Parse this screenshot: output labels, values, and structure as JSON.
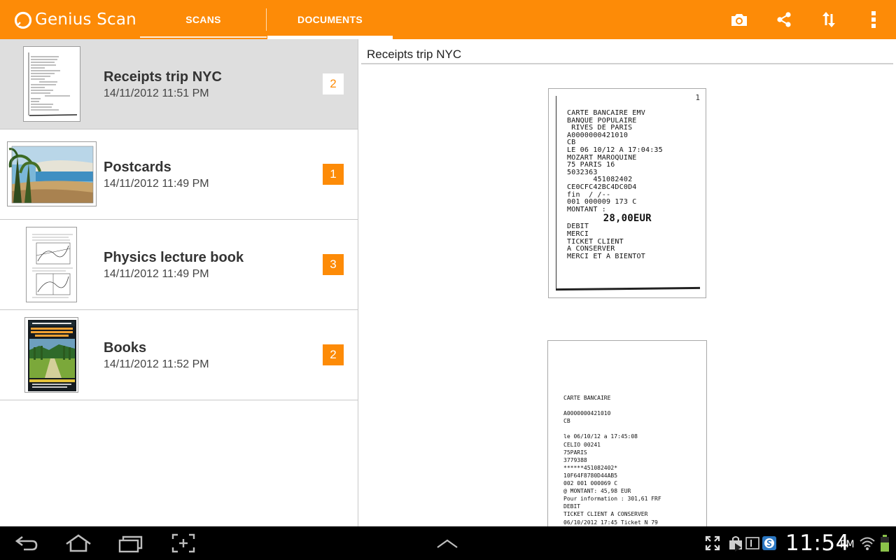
{
  "app": {
    "title": "Genius Scan",
    "accent_color": "#fd8b07",
    "logo_icon": "genius-scan-logo"
  },
  "tabs": [
    {
      "label": "SCANS",
      "selected": false
    },
    {
      "label": "DOCUMENTS",
      "selected": true
    }
  ],
  "actions": [
    {
      "icon": "camera-icon"
    },
    {
      "icon": "share-icon"
    },
    {
      "icon": "sort-icon"
    },
    {
      "icon": "overflow-menu-icon"
    }
  ],
  "documents": [
    {
      "title": "Receipts trip NYC",
      "date": "14/11/2012 11:51 PM",
      "pages": "2",
      "selected": true,
      "thumbnail": "receipt"
    },
    {
      "title": "Postcards",
      "date": "14/11/2012 11:49 PM",
      "pages": "1",
      "selected": false,
      "thumbnail": "postcard"
    },
    {
      "title": "Physics lecture book",
      "date": "14/11/2012 11:49 PM",
      "pages": "3",
      "selected": false,
      "thumbnail": "lecture"
    },
    {
      "title": "Books",
      "date": "14/11/2012 11:52 PM",
      "pages": "2",
      "selected": false,
      "thumbnail": "book-cover"
    }
  ],
  "detail": {
    "title": "Receipts trip NYC",
    "pages": [
      {
        "number": "1",
        "lines": [
          "CARTE BANCAIRE EMV",
          "BANQUE POPULAIRE",
          " RIVES DE PARIS",
          "A0000000421010",
          "CB",
          "LE 06 10/12 A 17:04:35",
          "MOZART MAROQUINE",
          "75 PARIS 16",
          "5032363",
          "      451082402",
          "CE0CFC42BC4DC0D4",
          "fin  / /--",
          "001 000009 173 C",
          "MONTANT :",
          "      28,00EUR",
          "DEBIT",
          "MERCI",
          "TICKET CLIENT",
          "A CONSERVER",
          "MERCI ET A BIENTOT"
        ]
      },
      {
        "lines": [
          "CARTE BANCAIRE",
          "",
          "A0000000421010",
          "CB",
          "",
          "le 06/10/12 a 17:45:08",
          "CELIO 00241",
          "75PARIS",
          "3779388",
          "******451082402*",
          "10F64F8780D44AB5",
          "002 001 000069 C",
          "@ MONTANT: 45,98 EUR",
          "Pour information : 301,61 FRF",
          "DEBIT",
          "TICKET CLIENT A CONSERVER",
          "06/10/2012 17:45 Ticket N 79"
        ]
      }
    ]
  },
  "status": {
    "time": "11:54",
    "ampm": "PM"
  },
  "navbar": {
    "buttons": [
      "back-icon",
      "home-icon",
      "recent-apps-icon",
      "screenshot-icon",
      "app-drawer-icon"
    ],
    "status_icons": [
      "fullscreen-icon",
      "shopping-bag-icon",
      "play-store-icon",
      "notification-count-icon",
      "skype-icon",
      "wifi-icon",
      "battery-icon"
    ]
  }
}
